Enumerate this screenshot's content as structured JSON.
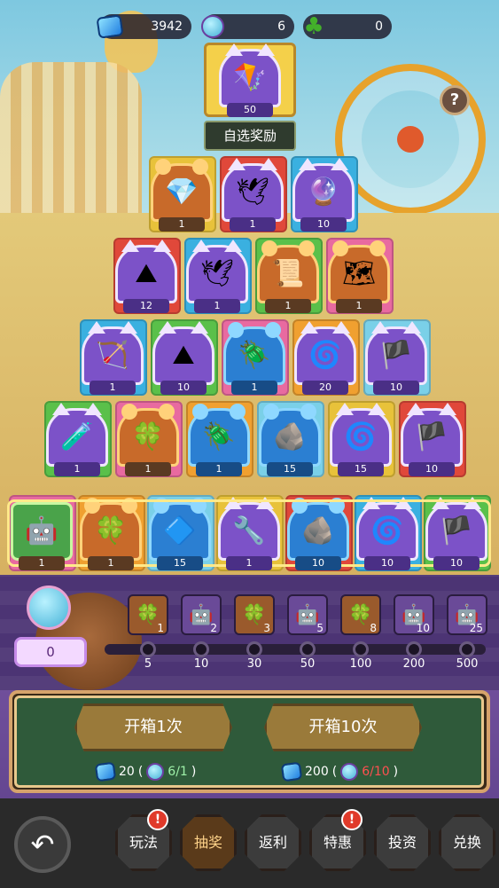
{
  "resources": {
    "gems": "3942",
    "robots": "6",
    "clovers": "0"
  },
  "top_prize": {
    "qty": "50",
    "icon": "kite-icon"
  },
  "choose_reward_label": "自选奖励",
  "help_label": "?",
  "rows": [
    {
      "items": [
        {
          "icon": "gem-icon",
          "qty": "1",
          "frame": "bear"
        },
        {
          "icon": "paper-crane-icon",
          "qty": "1",
          "frame": "cat"
        },
        {
          "icon": "amulet-icon",
          "qty": "10",
          "frame": "cat"
        }
      ]
    },
    {
      "items": [
        {
          "icon": "sand-pile-icon",
          "qty": "12",
          "frame": "cat"
        },
        {
          "icon": "paper-crane-icon",
          "qty": "1",
          "frame": "cat"
        },
        {
          "icon": "scroll-icon",
          "qty": "1",
          "frame": "bear"
        },
        {
          "icon": "map-icon",
          "qty": "1",
          "frame": "bear"
        }
      ]
    },
    {
      "items": [
        {
          "icon": "bow-icon",
          "qty": "1",
          "frame": "cat"
        },
        {
          "icon": "sand-pile-icon",
          "qty": "10",
          "frame": "cat"
        },
        {
          "icon": "dragonfly-icon",
          "qty": "1",
          "frame": "blue"
        },
        {
          "icon": "rune-icon",
          "qty": "20",
          "frame": "cat"
        },
        {
          "icon": "banner-icon",
          "qty": "10",
          "frame": "cat"
        }
      ]
    },
    {
      "items": [
        {
          "icon": "potion-icon",
          "qty": "1",
          "frame": "cat"
        },
        {
          "icon": "clover-icon",
          "qty": "1",
          "frame": "bear"
        },
        {
          "icon": "dragonfly-icon",
          "qty": "1",
          "frame": "blue"
        },
        {
          "icon": "ore-icon",
          "qty": "15",
          "frame": "blue"
        },
        {
          "icon": "rune-icon",
          "qty": "15",
          "frame": "cat"
        },
        {
          "icon": "banner-icon",
          "qty": "10",
          "frame": "cat"
        }
      ]
    },
    {
      "items": [
        {
          "icon": "robot-star-icon",
          "qty": "1",
          "frame": "star"
        },
        {
          "icon": "clover-icon",
          "qty": "1",
          "frame": "bear"
        },
        {
          "icon": "crystal-icon",
          "qty": "15",
          "frame": "blue"
        },
        {
          "icon": "wrench-icon",
          "qty": "1",
          "frame": "cat"
        },
        {
          "icon": "ore-icon",
          "qty": "10",
          "frame": "blue"
        },
        {
          "icon": "rune-icon",
          "qty": "10",
          "frame": "cat"
        },
        {
          "icon": "banner-icon",
          "qty": "10",
          "frame": "cat"
        }
      ]
    }
  ],
  "progress": {
    "counter": "0",
    "milestones": [
      {
        "reward_icon": "clover-icon",
        "reward_qty": "1",
        "threshold": "5",
        "state": "done"
      },
      {
        "reward_icon": "robot-icon",
        "reward_qty": "2",
        "threshold": "10",
        "state": "todo"
      },
      {
        "reward_icon": "clover-icon",
        "reward_qty": "3",
        "threshold": "30",
        "state": "done"
      },
      {
        "reward_icon": "robot-icon",
        "reward_qty": "5",
        "threshold": "50",
        "state": "todo"
      },
      {
        "reward_icon": "clover-icon",
        "reward_qty": "8",
        "threshold": "100",
        "state": "done"
      },
      {
        "reward_icon": "robot-icon",
        "reward_qty": "10",
        "threshold": "200",
        "state": "todo"
      },
      {
        "reward_icon": "robot-icon",
        "reward_qty": "25",
        "threshold": "500",
        "state": "todo"
      }
    ]
  },
  "actions": {
    "open_once_label": "开箱1次",
    "open_ten_label": "开箱10次",
    "once_cost_gems": "20",
    "once_cost_open": "(",
    "once_cost_robots": "6/1",
    "once_cost_close": ")",
    "ten_cost_gems": "200",
    "ten_cost_open": "(",
    "ten_cost_robots": "6/10",
    "ten_cost_close": ")"
  },
  "nav": {
    "back_icon": "back-arrow-icon",
    "tabs": [
      {
        "label": "玩法",
        "alert": true,
        "active": false
      },
      {
        "label": "抽奖",
        "alert": false,
        "active": true
      },
      {
        "label": "返利",
        "alert": false,
        "active": false
      },
      {
        "label": "特惠",
        "alert": true,
        "active": false
      },
      {
        "label": "投资",
        "alert": false,
        "active": false
      },
      {
        "label": "兑换",
        "alert": false,
        "active": false
      }
    ],
    "alert_glyph": "!"
  },
  "colors": {
    "accent_red": "#ff5050",
    "panel_green": "#2f5a3a",
    "highlight_yellow": "#ffe98a"
  }
}
